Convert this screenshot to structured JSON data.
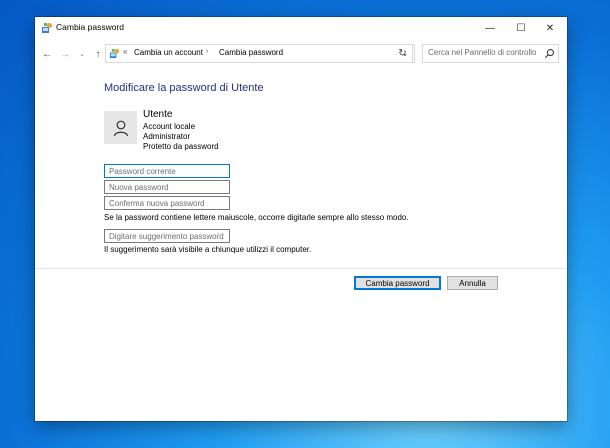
{
  "window": {
    "title": "Cambia password"
  },
  "titlebar": {
    "minimize": "—",
    "maximize": "☐",
    "close": "✕"
  },
  "nav": {
    "back": "←",
    "forward": "→",
    "recent": "⌄",
    "up": "↑",
    "refresh": "↻"
  },
  "address": {
    "prefix": "«",
    "crumbs": [
      "Cambia un account",
      "Cambia password"
    ],
    "separator": "›",
    "dropdown": "⌄"
  },
  "search": {
    "placeholder": "Cerca nel Pannello di controllo"
  },
  "main": {
    "heading": "Modificare la password di Utente",
    "user": {
      "name": "Utente",
      "details": [
        "Account locale",
        "Administrator",
        "Protetto da password"
      ]
    },
    "fields": {
      "current_password_placeholder": "Password corrente",
      "new_password_placeholder": "Nuova password",
      "confirm_password_placeholder": "Conferma nuova password",
      "hint_placeholder": "Digitare suggerimento password"
    },
    "caps_note": "Se la password contiene lettere maiuscole, occorre digitarle sempre allo stesso modo.",
    "hint_note": "Il suggerimento sarà visibile a chiunque utilizzi il computer."
  },
  "buttons": {
    "change_password": "Cambia password",
    "cancel": "Annulla"
  },
  "colors": {
    "heading": "#1e3287",
    "focus": "#0078d7",
    "desktop": "#0a6fd6"
  }
}
